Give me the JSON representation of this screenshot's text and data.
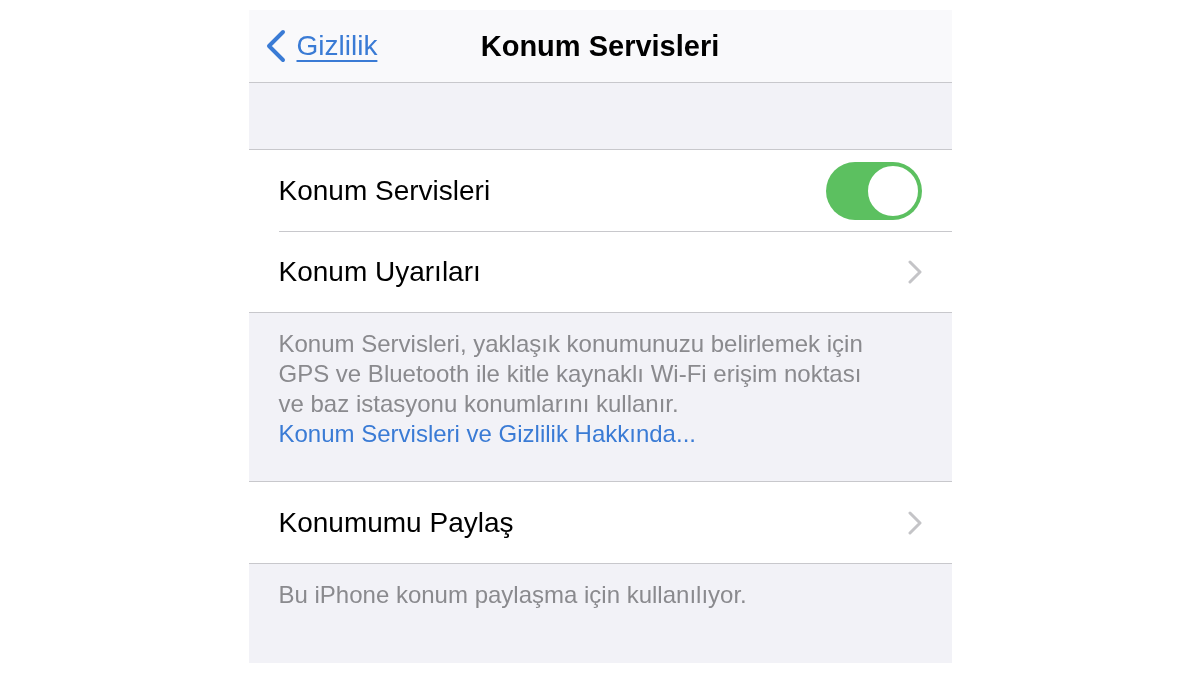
{
  "nav": {
    "back": "Gizlilik",
    "title": "Konum Servisleri"
  },
  "sections": [
    {
      "rows": [
        {
          "kind": "toggle",
          "label": "Konum Servisleri",
          "on": true
        },
        {
          "kind": "link",
          "label": "Konum Uyarıları"
        }
      ],
      "footer": {
        "text": "Konum Servisleri, yaklaşık konumunuzu belirlemek için GPS ve Bluetooth ile kitle kaynaklı Wi-Fi erişim noktası ve baz istasyonu konumlarını kullanır.",
        "link": "Konum Servisleri ve Gizlilik Hakkında..."
      }
    },
    {
      "rows": [
        {
          "kind": "link",
          "label": "Konumumu Paylaş"
        }
      ],
      "footer": {
        "text": "Bu iPhone konum paylaşma için kullanılıyor."
      }
    }
  ]
}
